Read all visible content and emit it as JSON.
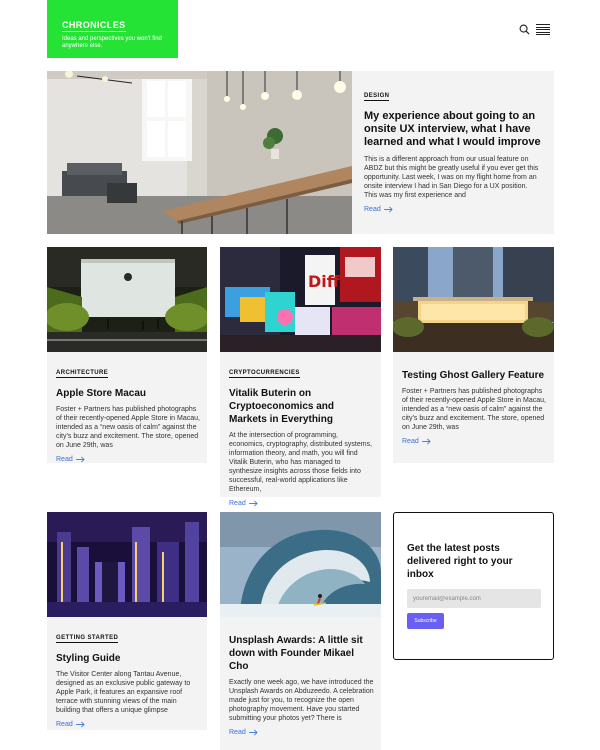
{
  "header": {
    "brand": "CHRONICLES",
    "tagline": "Ideas and perspectives you won't find anywhere else."
  },
  "colors": {
    "brand_green": "#25e335",
    "link_blue": "#3b6fd8",
    "button_purple": "#6a5ff5",
    "card_bg": "#f3f3f3"
  },
  "featured": {
    "tag": "DESIGN",
    "title": "My experience about going to an onsite UX interview, what I have learned and what I would improve",
    "excerpt": "This is a different approach from our usual feature on ABDZ but this might be greatly useful if you ever get this opportunity. Last week, I was on my flight home from an onsite interview I had in San Diego for a UX position. This was my first experience and",
    "read_label": "Read"
  },
  "posts": [
    {
      "tag": "ARCHITECTURE",
      "title": "Apple Store Macau",
      "excerpt": "Foster + Partners has published photographs of their recently-opened Apple Store in Macau, intended as a “new oasis of calm” against the city’s buzz and excitement. The store, opened on June 29th, was",
      "read_label": "Read"
    },
    {
      "tag": "CRYPTOCURRENCIES",
      "title": "Vitalik Buterin on Cryptoeconomics and Markets in Everything",
      "excerpt": "At the intersection of programming, economics, cryptography, distributed systems, information theory, and math, you will find Vitalik Buterin, who has managed to synthesize insights across those fields into successful, real-world applications like Ethereum,",
      "read_label": "Read"
    },
    {
      "tag": "",
      "title": "Testing Ghost Gallery Feature",
      "excerpt": "Foster + Partners has published photographs of their recently-opened Apple Store in Macau, intended as a “new oasis of calm” against the city’s buzz and excitement. The store, opened on June 29th, was",
      "read_label": "Read"
    },
    {
      "tag": "GETTING STARTED",
      "title": "Styling Guide",
      "excerpt": "The Visitor Center along Tantau Avenue, designed as an exclusive public gateway to Apple Park, it features an expansive roof terrace with stunning views of the main building that offers a unique glimpse",
      "read_label": "Read"
    },
    {
      "tag": "",
      "title": "Unsplash Awards: A little sit down with Founder Mikael Cho",
      "excerpt": "Exactly one week ago, we have introduced the Unsplash Awards on Abduzeedo. A celebration made just for you, to recognize the open photography movement. Have you started submitting your photos yet? There is",
      "read_label": "Read"
    }
  ],
  "newsletter": {
    "title": "Get the latest posts delivered right to your inbox",
    "placeholder": "youremail@example.com",
    "button": "Subscribe"
  }
}
